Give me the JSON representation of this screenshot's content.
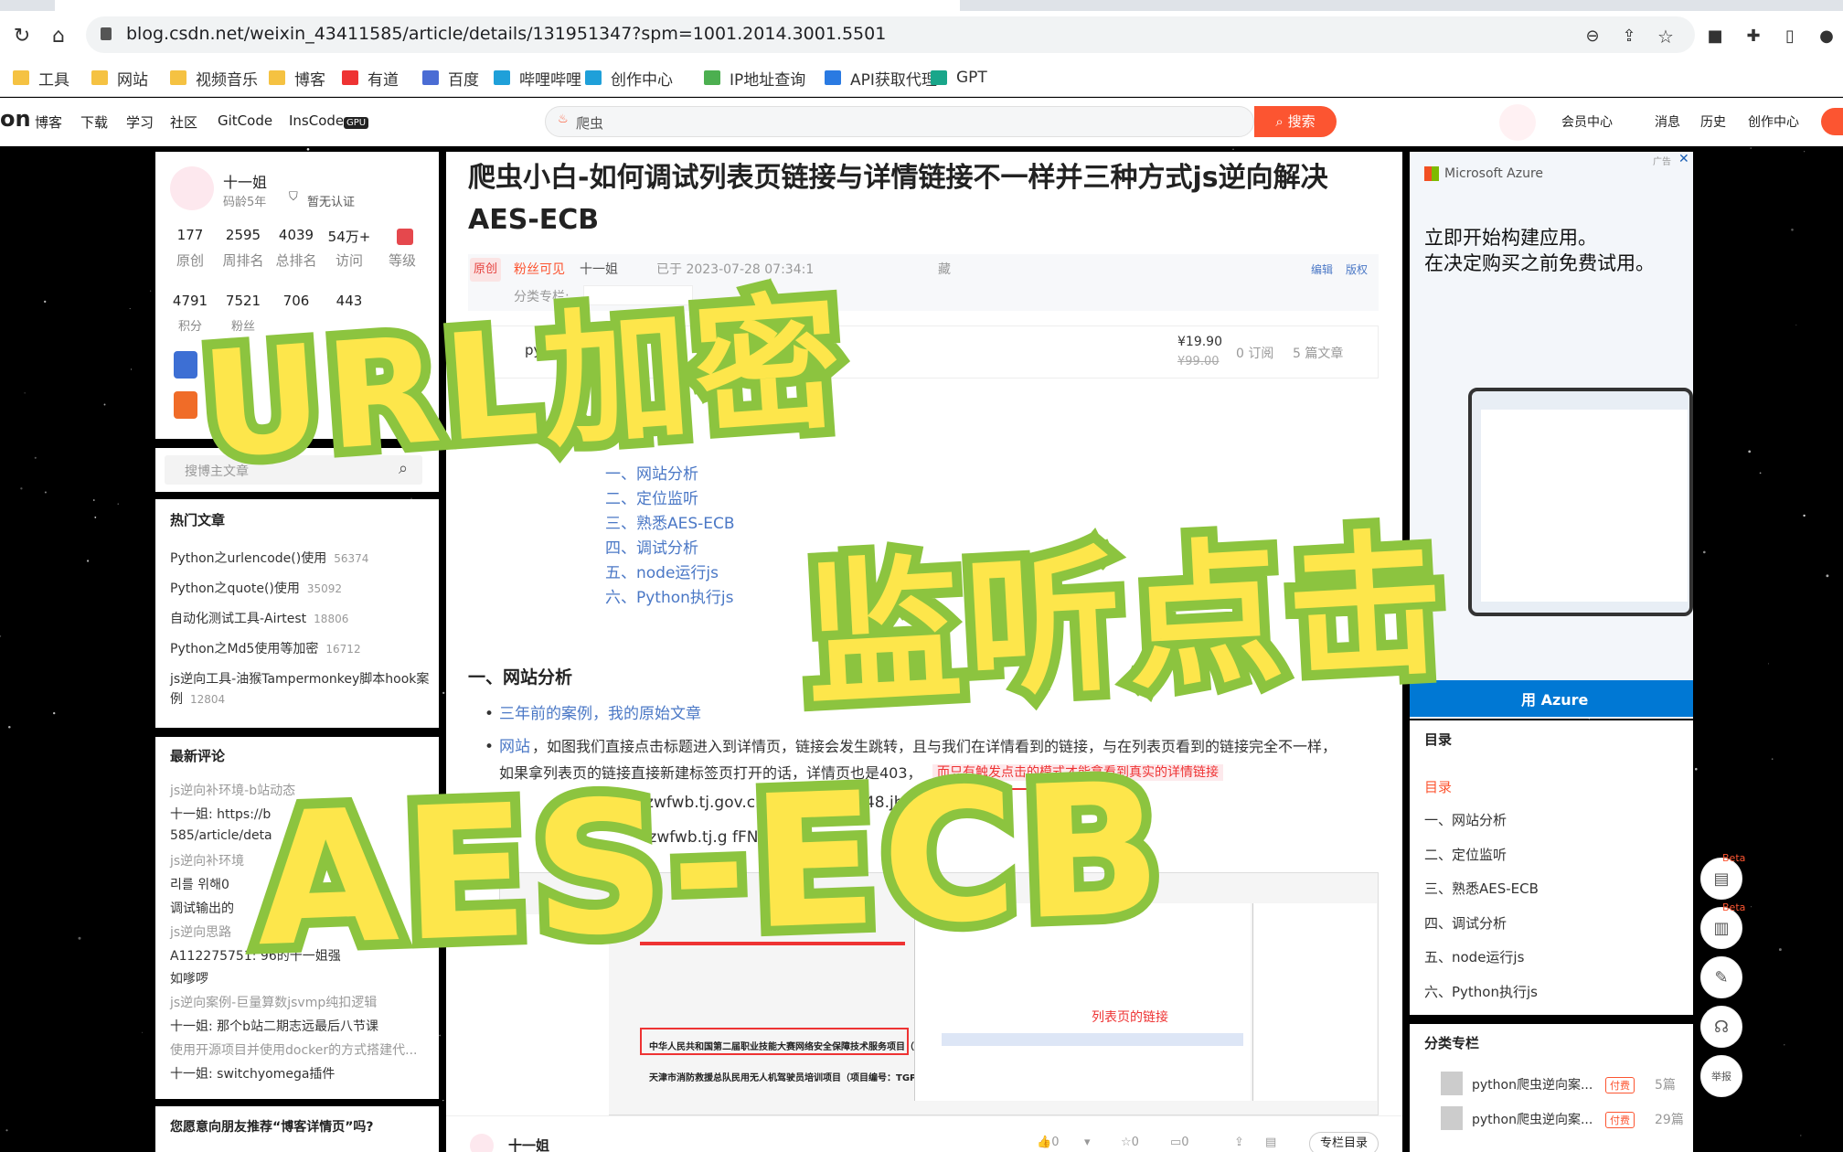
{
  "browser": {
    "url": "blog.csdn.net/weixin_43411585/article/details/131951347?spm=1001.2014.3001.5501",
    "bookmarks": [
      "工具",
      "网站",
      "视频音乐",
      "博客",
      "有道",
      "百度",
      "哔哩哔哩",
      "创作中心",
      "IP地址查询",
      "API获取代理",
      "GPT"
    ]
  },
  "site": {
    "logo_fragment": "on",
    "nav": [
      "博客",
      "下载",
      "学习",
      "社区",
      "GitCode",
      "InsCode"
    ],
    "gpu_badge": "GPU",
    "search_placeholder": "爬虫",
    "search_button": "搜索",
    "right_nav": [
      "会员中心",
      "消息",
      "历史",
      "创作中心"
    ]
  },
  "profile": {
    "name": "十一姐",
    "age": "码龄5年",
    "auth": "暂无认证",
    "stats1": [
      {
        "n": "177",
        "l": "原创"
      },
      {
        "n": "2595",
        "l": "周排名"
      },
      {
        "n": "4039",
        "l": "总排名"
      },
      {
        "n": "54万+",
        "l": "访问"
      },
      {
        "n": "",
        "l": "等级"
      }
    ],
    "stats2": [
      {
        "n": "4791",
        "l": "积分"
      },
      {
        "n": "7521",
        "l": "粉丝"
      },
      {
        "n": "706",
        "l": ""
      },
      {
        "n": "443",
        "l": ""
      }
    ],
    "search_placeholder": "搜博主文章"
  },
  "hot": {
    "title": "热门文章",
    "items": [
      {
        "t": "Python之urlencode()使用",
        "c": "56374"
      },
      {
        "t": "Python之quote()使用",
        "c": "35092"
      },
      {
        "t": "自动化测试工具-Airtest",
        "c": "18806"
      },
      {
        "t": "Python之Md5使用等加密",
        "c": "16712"
      },
      {
        "t": "js逆向工具-油猴Tampermonkey脚本hook案",
        "c": ""
      },
      {
        "t": "例",
        "c": "12804"
      }
    ]
  },
  "comments": {
    "title": "最新评论",
    "lines": [
      {
        "t": "js逆向补环境-b站动态",
        "gray": true
      },
      {
        "t": "十一姐: https://b",
        "gray": false
      },
      {
        "t": "585/article/deta",
        "gray": false
      },
      {
        "t": "js逆向补环境",
        "gray": true
      },
      {
        "t": "리를 위해0",
        "gray": false
      },
      {
        "t": "调试输出的",
        "gray": false
      },
      {
        "t": "js逆向思路",
        "gray": true
      },
      {
        "t": "A112275751: 96的十一姐强",
        "gray": false
      },
      {
        "t": "如嗲啰",
        "gray": false
      },
      {
        "t": "js逆向案例-巨量算数jsvmp纯扣逻辑",
        "gray": true
      },
      {
        "t": "十一姐: 那个b站二期志远最后八节课",
        "gray": false
      },
      {
        "t": "使用开源项目并使用docker的方式搭建代...",
        "gray": true
      },
      {
        "t": "十一姐: switchyomega插件",
        "gray": false
      }
    ],
    "recommend": "您愿意向朋友推荐“博客详情页”吗?"
  },
  "article": {
    "title": "爬虫小白-如何调试列表页链接与详情链接不一样并三种方式js逆向解决AES-ECB",
    "badge_original": "原创",
    "fans_visible": "粉丝可见",
    "author": "十一姐",
    "date": "已于 2023-07-28 07:34:1",
    "collect": "藏",
    "edit": "编辑",
    "copyright": "版权",
    "column_label": "分类专栏:",
    "column_name": "python",
    "price": "¥19.90",
    "old_price": "¥99.00",
    "subs": "0 订阅",
    "count": "5 篇文章",
    "toc": [
      "一、网站分析",
      "二、定位监听",
      "三、熟悉AES-ECB",
      "四、调试分析",
      "五、node运行js",
      "六、Python执行js"
    ],
    "h1": "一、网站分析",
    "b1": "三年前的案例，我的原始文章",
    "b2_link": "网站",
    "b2_text": "，如图我们直接点击标题进入到详情页，链接会发生跳转，且与我们在详情看到的链接，与在列表页看到的链接完全不一样，",
    "b2_cont": "如果拿列表页的链接直接新建标签页打开的话，详情页也是403，",
    "b2_red": "而只有触发点击的模式才能拿看到真实的详情链接",
    "url1": "ry.zwfwb.tj.gov.cn/80/            g/1025448.jhtml",
    "url2": ".zwfwb.tj.g             fFNS            D5T",
    "shot_label": "列表页的链接",
    "shot_rows": [
      "中华人民共和国第二届职业技能大赛网络安全保障技术服务项目（项目编号",
      "天津市消防救援总队民用无人机驾驶员培训项目（项目编号：TGPC-2023"
    ],
    "footer_name": "十一姐",
    "footer_counts": [
      "0",
      "",
      "0",
      "0"
    ],
    "footer_btn": "专栏目录"
  },
  "ad": {
    "tag": "广告",
    "brand": "Microsoft Azure",
    "line1": "立即开始构建应用。",
    "line2": "在决定购买之前免费试用。",
    "cta": "用 Azure"
  },
  "right_toc": {
    "title": "目录",
    "active": "目录",
    "items": [
      "一、网站分析",
      "二、定位监听",
      "三、熟悉AES-ECB",
      "四、调试分析",
      "五、node运行js",
      "六、Python执行js"
    ]
  },
  "right_cols": {
    "title": "分类专栏",
    "items": [
      {
        "t": "python爬虫逆向案...",
        "b": "付费",
        "c": "5篇"
      },
      {
        "t": "python爬虫逆向案...",
        "b": "付费",
        "c": "29篇"
      }
    ]
  },
  "fab": {
    "beta": "Beta",
    "report": "举报"
  },
  "overlay": {
    "line1": "URL加密",
    "line2": "监听点击",
    "line3": "AES-ECB"
  },
  "colors": {
    "accent": "#fc5531",
    "overlay_fill": "#fde64b",
    "overlay_stroke": "#8cc43f",
    "link": "#4b78c6"
  }
}
